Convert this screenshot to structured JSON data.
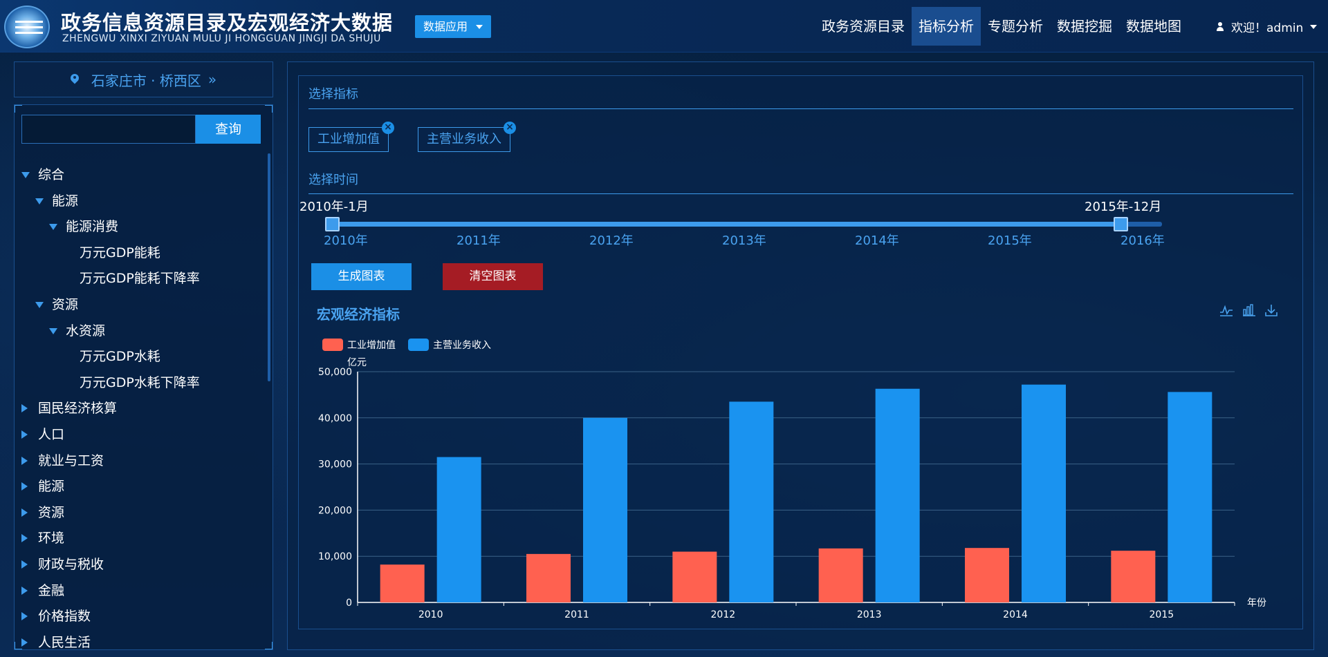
{
  "header": {
    "title_cn": "政务信息资源目录及宏观经济大数据",
    "title_en": "ZHENGWU XINXI ZIYUAN MULU JI HONGGUAN JINGJI DA SHUJU",
    "data_app_label": "数据应用",
    "nav": [
      "政务资源目录",
      "指标分析",
      "专题分析",
      "数据挖掘",
      "数据地图"
    ],
    "active_nav": "指标分析",
    "user_label": "欢迎！admin"
  },
  "sidebar": {
    "location": "石家庄市 · 桥西区",
    "search_button": "查询",
    "search_value": "",
    "tree": [
      {
        "label": "综合",
        "level": 0,
        "expanded": true
      },
      {
        "label": "能源",
        "level": 1,
        "expanded": true
      },
      {
        "label": "能源消费",
        "level": 2,
        "expanded": true
      },
      {
        "label": "万元GDP能耗",
        "level": 3
      },
      {
        "label": "万元GDP能耗下降率",
        "level": 3
      },
      {
        "label": "资源",
        "level": 1,
        "expanded": true
      },
      {
        "label": "水资源",
        "level": 2,
        "expanded": true
      },
      {
        "label": "万元GDP水耗",
        "level": 3
      },
      {
        "label": "万元GDP水耗下降率",
        "level": 3
      },
      {
        "label": "国民经济核算",
        "level": 0,
        "expanded": false
      },
      {
        "label": "人口",
        "level": 0,
        "expanded": false
      },
      {
        "label": "就业与工资",
        "level": 0,
        "expanded": false
      },
      {
        "label": "能源",
        "level": 0,
        "expanded": false
      },
      {
        "label": "资源",
        "level": 0,
        "expanded": false
      },
      {
        "label": "环境",
        "level": 0,
        "expanded": false
      },
      {
        "label": "财政与税收",
        "level": 0,
        "expanded": false
      },
      {
        "label": "金融",
        "level": 0,
        "expanded": false
      },
      {
        "label": "价格指数",
        "level": 0,
        "expanded": false
      },
      {
        "label": "人民生活",
        "level": 0,
        "expanded": false
      }
    ]
  },
  "main": {
    "select_indicator_title": "选择指标",
    "selected_indicators": [
      "工业增加值",
      "主营业务收入"
    ],
    "select_time_title": "选择时间",
    "range_start_label": "2010年-1月",
    "range_end_label": "2015年-12月",
    "range_start_fraction": 0,
    "range_end_fraction": 0.95,
    "year_ticks": [
      "2010年",
      "2011年",
      "2012年",
      "2013年",
      "2014年",
      "2015年",
      "2016年"
    ],
    "generate_button": "生成图表",
    "clear_button": "清空图表",
    "tool_icons": [
      "line-chart-icon",
      "bar-chart-icon",
      "download-icon"
    ]
  },
  "chart_data": {
    "type": "bar",
    "title": "宏观经济指标",
    "ylabel": "亿元",
    "xlabel": "年份",
    "categories": [
      "2010",
      "2011",
      "2012",
      "2013",
      "2014",
      "2015"
    ],
    "series": [
      {
        "name": "工业增加值",
        "color": "#ff6150",
        "values": [
          8200,
          10500,
          11000,
          11700,
          11800,
          11200
        ]
      },
      {
        "name": "主营业务收入",
        "color": "#1a93f0",
        "values": [
          31500,
          40000,
          43500,
          46300,
          47200,
          45600
        ]
      }
    ],
    "ylim": [
      0,
      50000
    ],
    "yticks": [
      "0",
      "10,000",
      "20,000",
      "30,000",
      "40,000",
      "50,000"
    ],
    "grid": true,
    "legend": "top-left"
  }
}
